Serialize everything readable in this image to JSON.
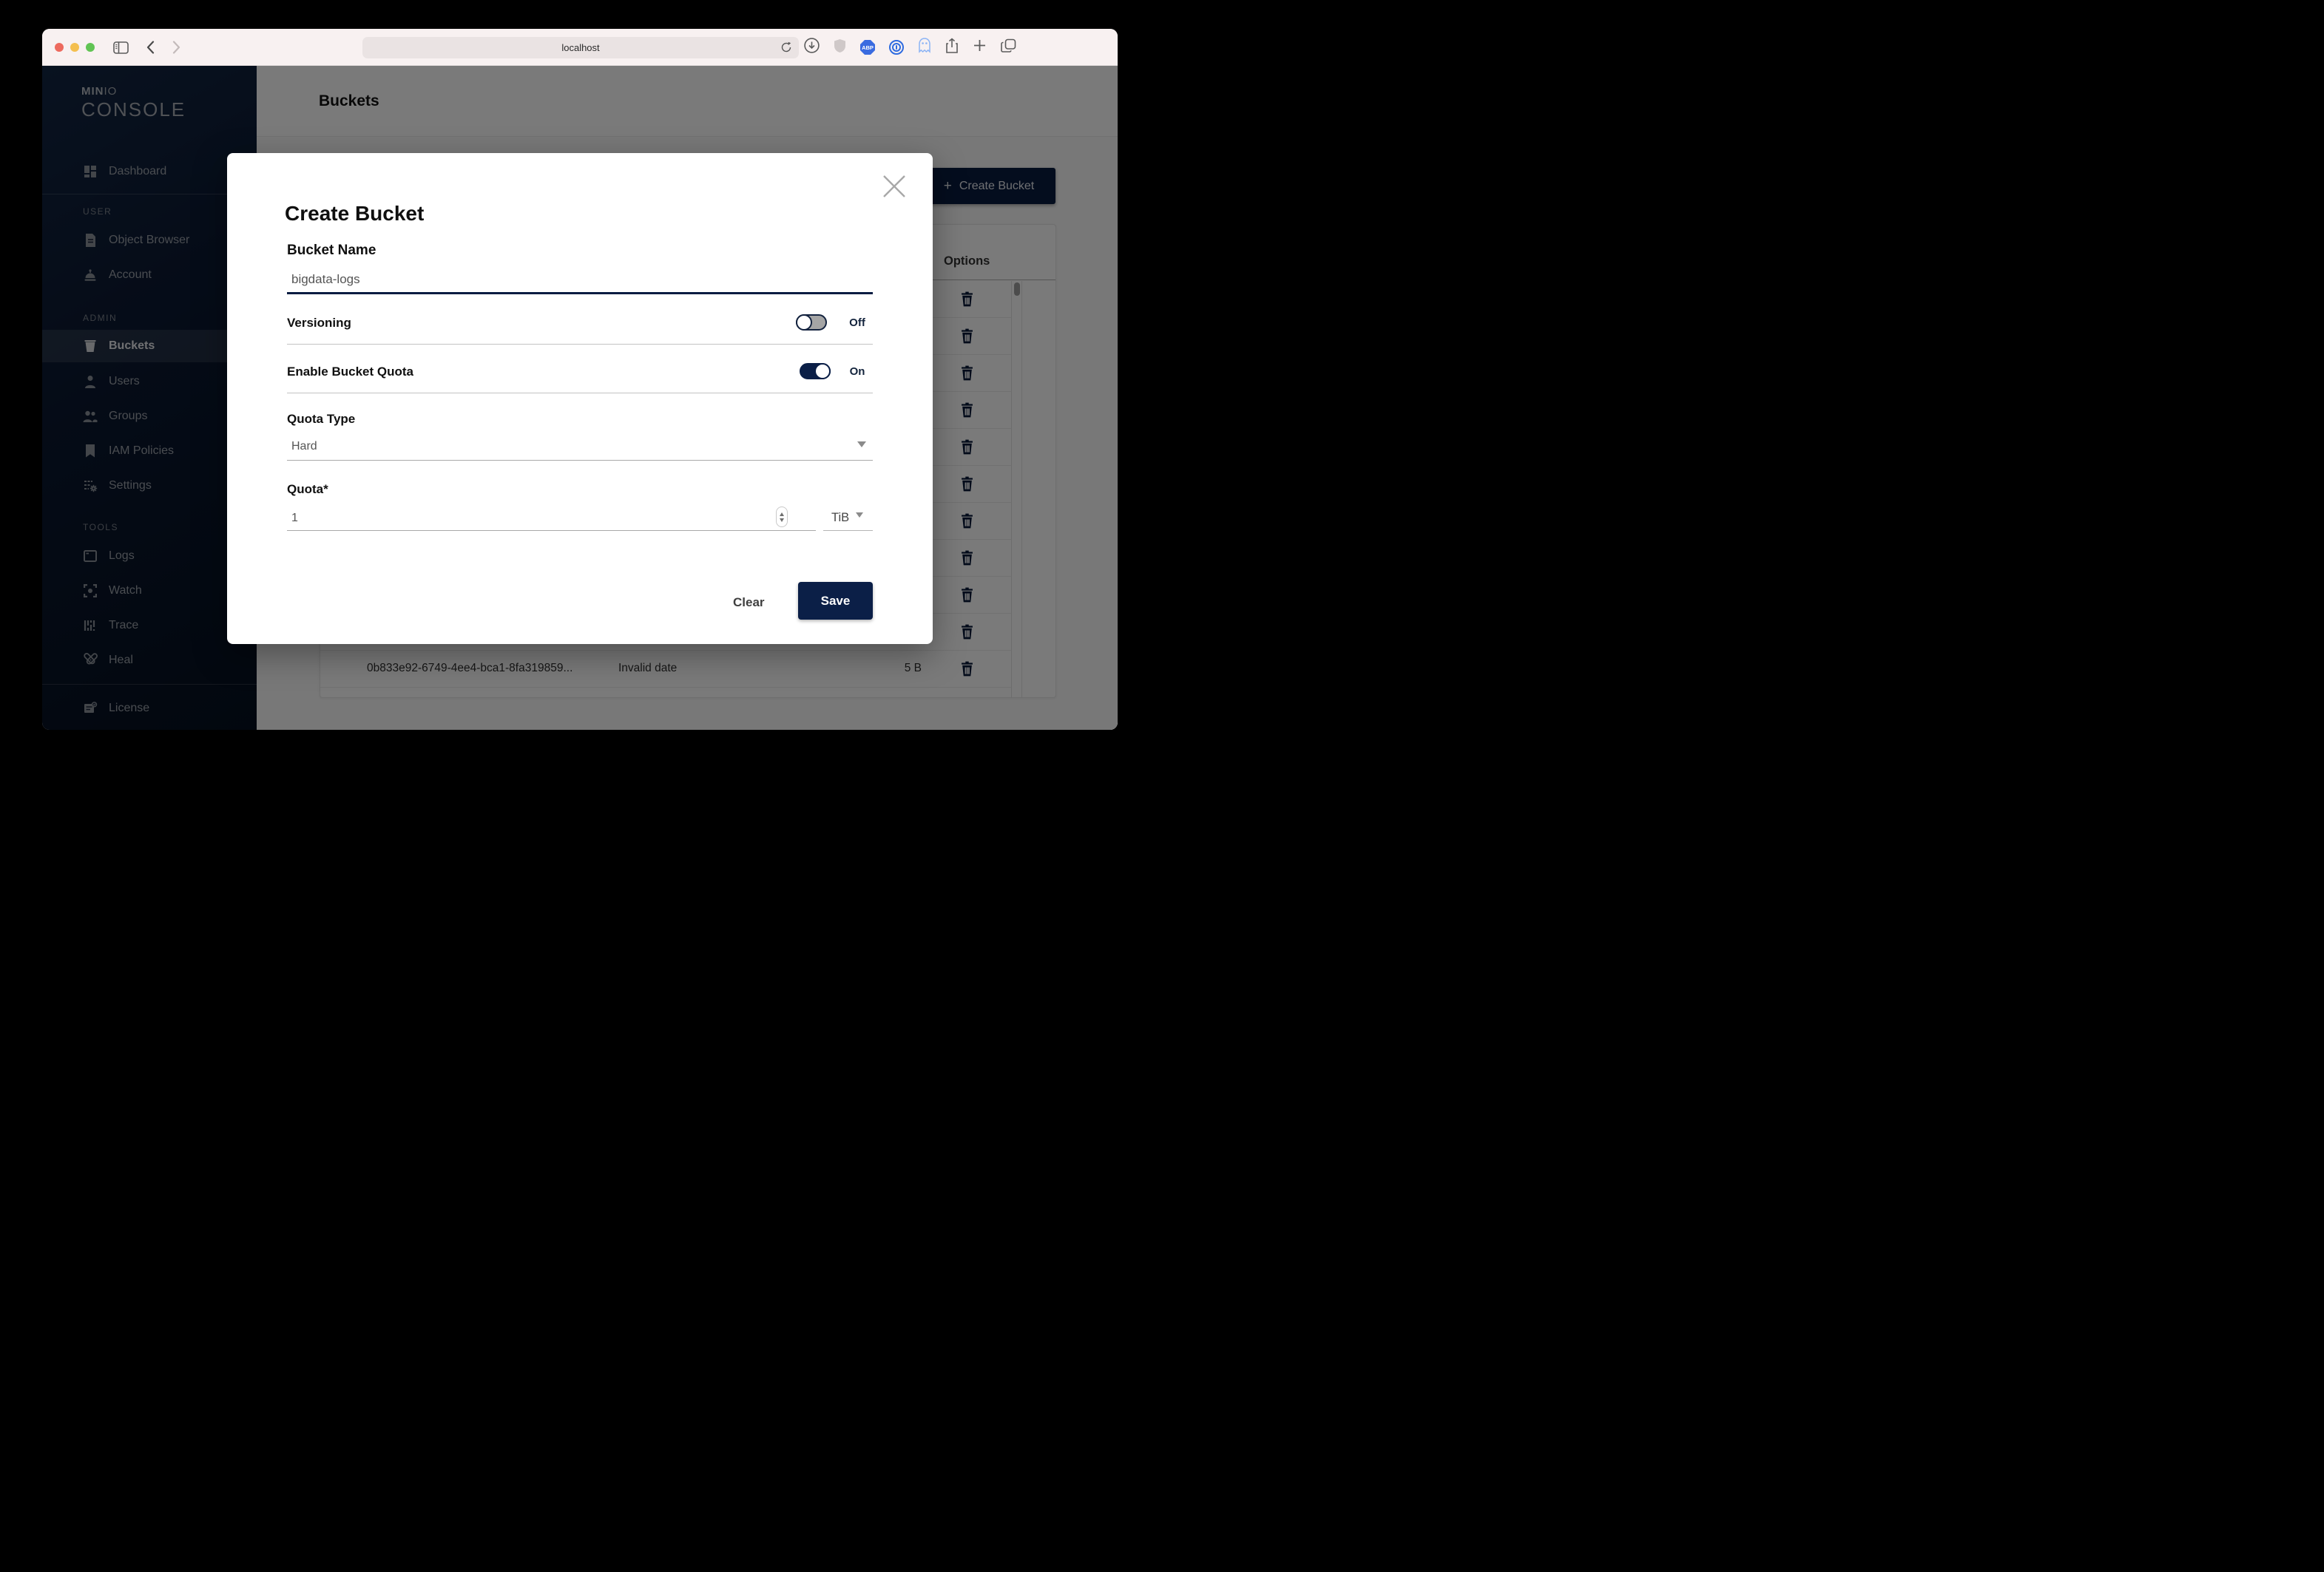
{
  "colors": {
    "primary_navy": "#081C42",
    "chrome_bg": "#F8F1F1",
    "page_bg": "#FAFAFA",
    "overlay": "rgba(0,0,0,0.52)"
  },
  "browser": {
    "url_value": "localhost"
  },
  "sidebar": {
    "logo": {
      "brand_bold": "MIN",
      "brand_light": "IO",
      "product": "CONSOLE"
    },
    "dashboard": "Dashboard",
    "user_section": "USER",
    "object_browser": "Object Browser",
    "account": "Account",
    "admin_section": "ADMIN",
    "buckets": "Buckets",
    "users": "Users",
    "groups": "Groups",
    "iam_policies": "IAM Policies",
    "settings": "Settings",
    "tools_section": "TOOLS",
    "logs": "Logs",
    "watch": "Watch",
    "trace": "Trace",
    "heal": "Heal",
    "license": "License"
  },
  "page": {
    "title": "Buckets",
    "create_button_plus": "+",
    "create_button_label": "Create Bucket"
  },
  "table": {
    "options_header": "Options",
    "rows": [
      {
        "name": "",
        "date": "",
        "size": ""
      },
      {
        "name": "",
        "date": "",
        "size": ""
      },
      {
        "name": "",
        "date": "",
        "size": ""
      },
      {
        "name": "",
        "date": "",
        "size": ""
      },
      {
        "name": "",
        "date": "",
        "size": ""
      },
      {
        "name": "",
        "date": "",
        "size": ""
      },
      {
        "name": "",
        "date": "",
        "size": ""
      },
      {
        "name": "",
        "date": "",
        "size": ""
      },
      {
        "name": "",
        "date": "",
        "size": ""
      },
      {
        "name": "",
        "date": "",
        "size": ""
      },
      {
        "name": "0b833e92-6749-4ee4-bca1-8fa319859...",
        "date": "Invalid date",
        "size": "5 B"
      }
    ]
  },
  "modal": {
    "title": "Create Bucket",
    "bucket_name_label": "Bucket Name",
    "bucket_name_value": "bigdata-logs",
    "versioning_label": "Versioning",
    "versioning_state": "Off",
    "quota_toggle_label": "Enable Bucket Quota",
    "quota_toggle_state": "On",
    "quota_type_label": "Quota Type",
    "quota_type_value": "Hard",
    "quota_label": "Quota*",
    "quota_value": "1",
    "quota_unit": "TiB",
    "clear_button": "Clear",
    "save_button": "Save"
  }
}
